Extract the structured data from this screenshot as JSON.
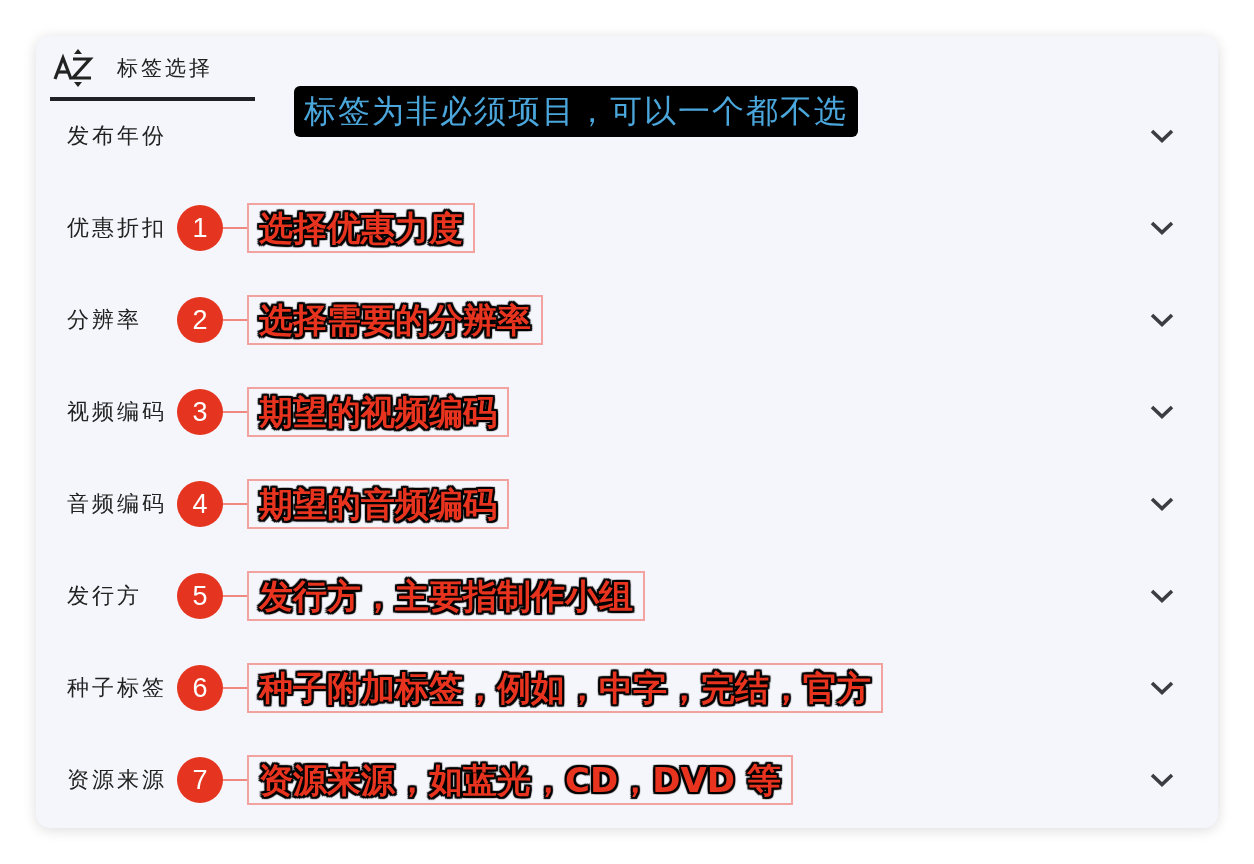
{
  "tabs": [
    {
      "label": "标签选择",
      "selected": true
    }
  ],
  "tooltip": {
    "text": "标签为非必须项目，可以一个都不选"
  },
  "filters": [
    {
      "label": "发布年份",
      "expanded": false
    },
    {
      "label": "优惠折扣",
      "expanded": false,
      "callout": {
        "number": "1",
        "text": "选择优惠力度"
      }
    },
    {
      "label": "分辨率",
      "expanded": false,
      "callout": {
        "number": "2",
        "text": "选择需要的分辨率"
      }
    },
    {
      "label": "视频编码",
      "expanded": false,
      "callout": {
        "number": "3",
        "text": "期望的视频编码"
      }
    },
    {
      "label": "音频编码",
      "expanded": false,
      "callout": {
        "number": "4",
        "text": "期望的音频编码"
      }
    },
    {
      "label": "发行方",
      "expanded": false,
      "callout": {
        "number": "5",
        "text": "发行方，主要指制作小组"
      }
    },
    {
      "label": "种子标签",
      "expanded": false,
      "callout": {
        "number": "6",
        "text": "种子附加标签，例如，中字，完结，官方"
      }
    },
    {
      "label": "资源来源",
      "expanded": false,
      "callout": {
        "number": "7",
        "text": "资源来源，如蓝光，CD，DVD 等"
      }
    }
  ]
}
